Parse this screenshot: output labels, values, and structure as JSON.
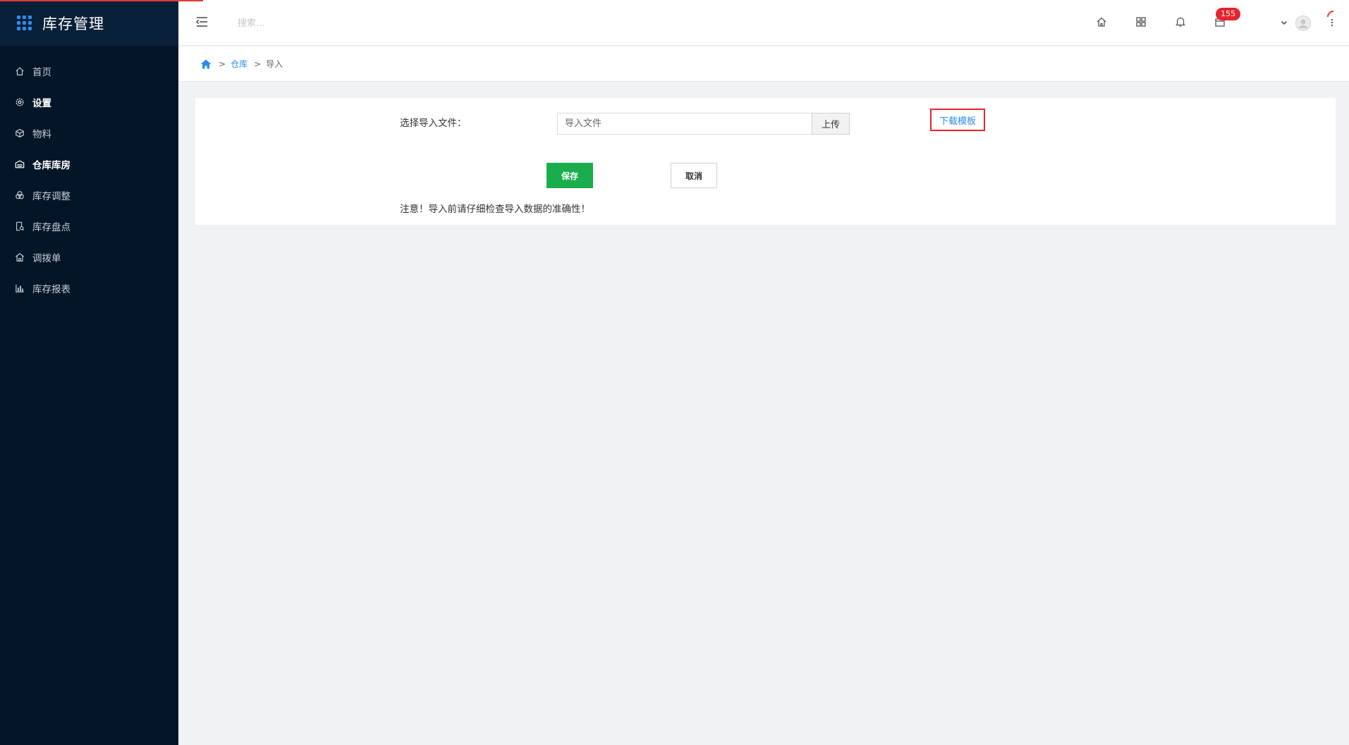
{
  "app": {
    "title": "库存管理"
  },
  "sidebar": {
    "items": [
      {
        "label": "首页",
        "icon": "home-icon",
        "bold": false
      },
      {
        "label": "设置",
        "icon": "gear-icon",
        "bold": true
      },
      {
        "label": "物料",
        "icon": "box-icon",
        "bold": false
      },
      {
        "label": "仓库库房",
        "icon": "warehouse-icon",
        "bold": true
      },
      {
        "label": "库存调整",
        "icon": "adjust-icon",
        "bold": false
      },
      {
        "label": "库存盘点",
        "icon": "inventory-check-icon",
        "bold": false
      },
      {
        "label": "调拨单",
        "icon": "transfer-icon",
        "bold": false
      },
      {
        "label": "库存报表",
        "icon": "bar-chart-icon",
        "bold": false
      }
    ]
  },
  "header": {
    "search_placeholder": "搜索...",
    "badge_count": "155"
  },
  "breadcrumb": {
    "items": [
      "仓库",
      "导入"
    ],
    "separator": ">"
  },
  "form": {
    "select_file_label": "选择导入文件：",
    "file_placeholder": "导入文件",
    "upload_label": "上传",
    "download_template_label": "下载模板",
    "save_label": "保存",
    "cancel_label": "取消",
    "note": "注意！导入前请仔细检查导入数据的准确性！"
  },
  "colors": {
    "sidebar_bg": "#041527",
    "accent": "#2d8cf0",
    "save_green": "#1aad4b",
    "badge_red": "#e8242c",
    "highlight_red": "#e8242c"
  }
}
